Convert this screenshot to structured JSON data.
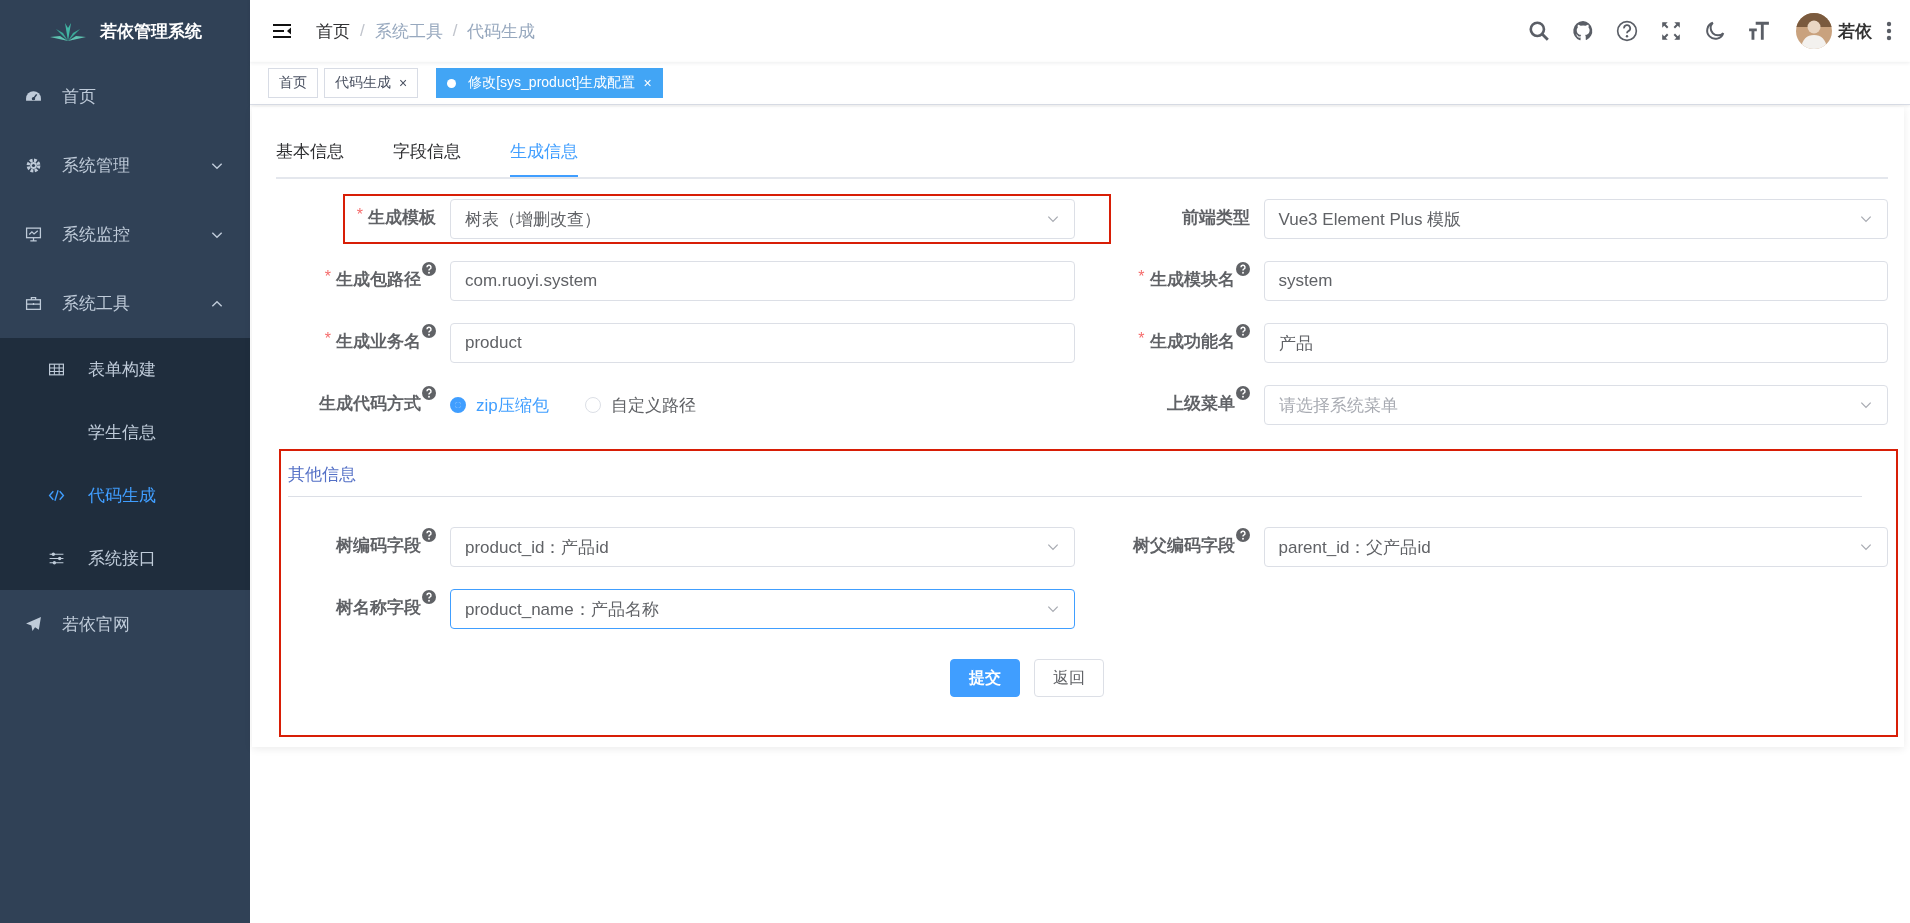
{
  "sidebar": {
    "logo_title": "若依管理系统",
    "menu": [
      {
        "label": "首页",
        "selected": false
      },
      {
        "label": "系统管理",
        "expanded": false,
        "selected": false
      },
      {
        "label": "系统监控",
        "expanded": false,
        "selected": false
      },
      {
        "label": "系统工具",
        "expanded": true,
        "selected": false,
        "children": [
          {
            "label": "表单构建",
            "selected": false
          },
          {
            "label": "学生信息",
            "selected": false
          },
          {
            "label": "代码生成",
            "selected": true
          },
          {
            "label": "系统接口",
            "selected": false
          }
        ]
      },
      {
        "label": "若依官网",
        "selected": false
      }
    ]
  },
  "header": {
    "breadcrumbs": [
      "首页",
      "系统工具",
      "代码生成"
    ],
    "separator": "/",
    "user_name": "若依"
  },
  "tags": [
    {
      "label": "首页",
      "selected": false,
      "closable": false
    },
    {
      "label": "代码生成",
      "selected": false,
      "closable": true
    },
    {
      "label": "修改[sys_product]生成配置",
      "selected": true,
      "closable": true
    }
  ],
  "close_glyph": "×",
  "form_tabs": [
    {
      "label": "基本信息",
      "selected": false
    },
    {
      "label": "字段信息",
      "selected": false
    },
    {
      "label": "生成信息",
      "selected": true
    }
  ],
  "fields": [
    {
      "label": "生成模板",
      "kind": "select",
      "required": true,
      "help": false,
      "value": "树表（增删改查）",
      "annotated": true
    },
    {
      "label": "前端类型",
      "kind": "select",
      "required": false,
      "help": false,
      "value": "Vue3 Element Plus 模版"
    },
    {
      "label": "生成包路径",
      "kind": "input",
      "required": true,
      "help": true,
      "value": "com.ruoyi.system"
    },
    {
      "label": "生成模块名",
      "kind": "input",
      "required": true,
      "help": true,
      "value": "system"
    },
    {
      "label": "生成业务名",
      "kind": "input",
      "required": true,
      "help": true,
      "value": "product"
    },
    {
      "label": "生成功能名",
      "kind": "input",
      "required": true,
      "help": true,
      "value": "产品"
    },
    {
      "label": "生成代码方式",
      "kind": "radio",
      "required": false,
      "help": true,
      "options": [
        {
          "label": "zip压缩包",
          "selected": true
        },
        {
          "label": "自定义路径",
          "selected": false
        }
      ]
    },
    {
      "label": "上级菜单",
      "kind": "select",
      "required": false,
      "help": true,
      "placeholder": "请选择系统菜单"
    }
  ],
  "required_mark": "*",
  "other_info": {
    "title": "其他信息",
    "annotated": true,
    "fields": [
      {
        "label": "树编码字段",
        "kind": "select",
        "required": false,
        "help": true,
        "value": "product_id：产品id",
        "focused": false
      },
      {
        "label": "树父编码字段",
        "kind": "select",
        "required": false,
        "help": true,
        "value": "parent_id：父产品id",
        "focused": false
      },
      {
        "label": "树名称字段",
        "kind": "select",
        "required": false,
        "help": true,
        "value": "product_name：产品名称",
        "focused": true
      }
    ]
  },
  "buttons": [
    {
      "label": "提交",
      "kind": "primary"
    },
    {
      "label": "返回",
      "kind": "default"
    }
  ]
}
